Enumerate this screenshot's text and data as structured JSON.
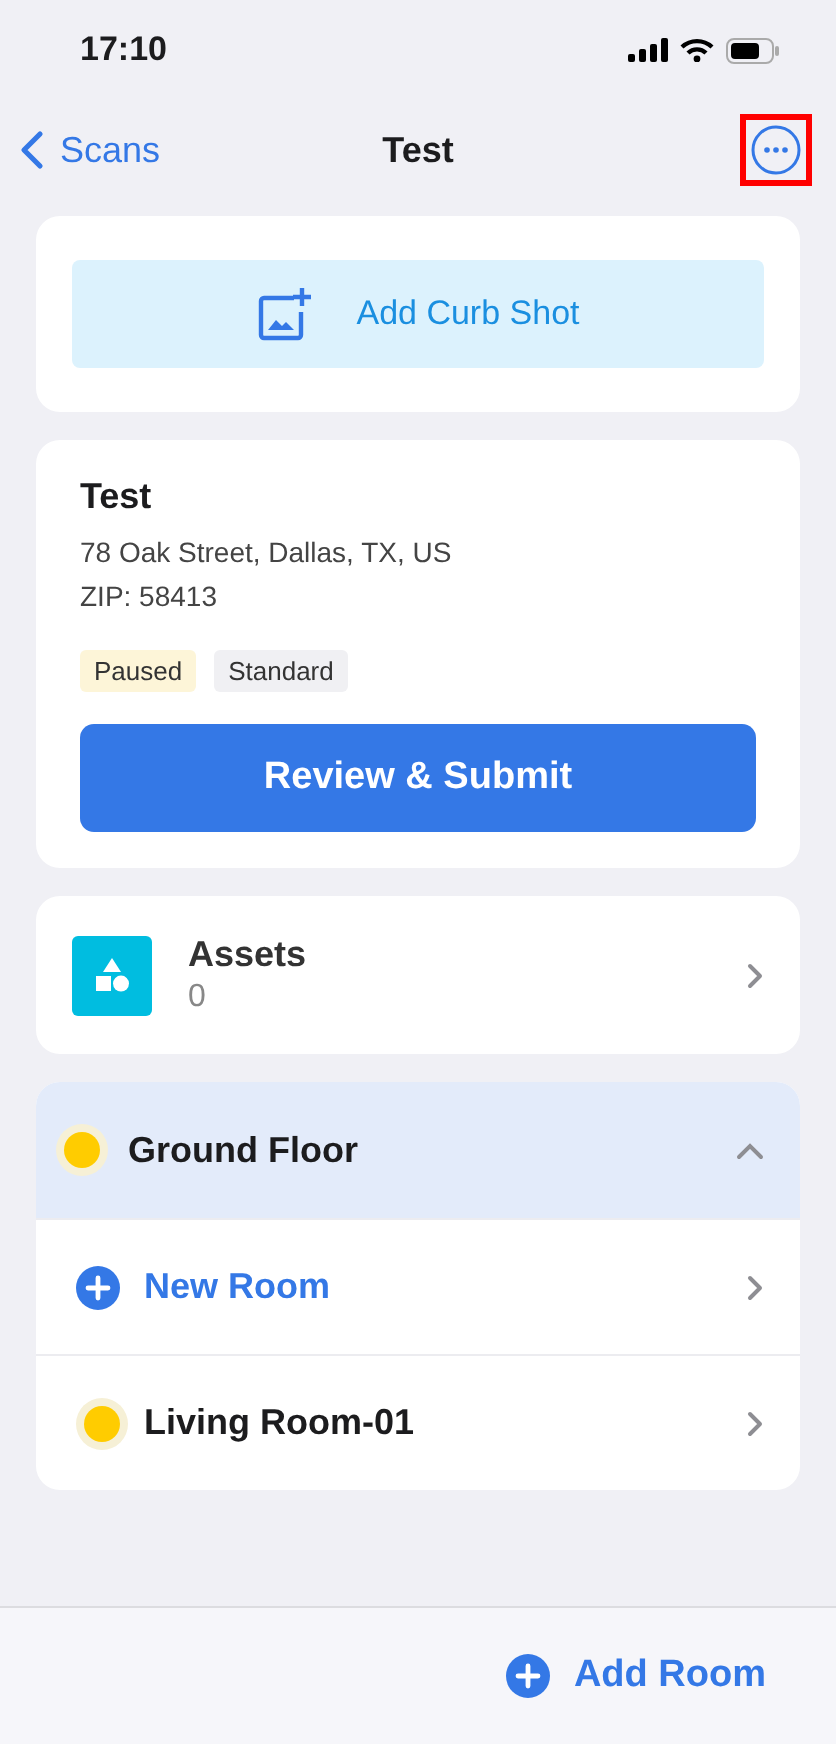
{
  "status_bar": {
    "time": "17:10"
  },
  "nav": {
    "back_label": "Scans",
    "title": "Test",
    "more_highlighted": true
  },
  "curb_shot": {
    "label": "Add Curb Shot"
  },
  "scan": {
    "name": "Test",
    "address": "78 Oak Street, Dallas, TX, US",
    "zip": "ZIP: 58413",
    "tags": [
      {
        "label": "Paused",
        "kind": "status"
      },
      {
        "label": "Standard",
        "kind": "plain"
      }
    ],
    "submit_label": "Review & Submit"
  },
  "assets": {
    "label": "Assets",
    "count": "0"
  },
  "floors": [
    {
      "name": "Ground Floor",
      "color": "#ffcc00",
      "expanded": true,
      "rooms": [
        {
          "kind": "new",
          "name": "New Room"
        },
        {
          "kind": "room",
          "name": "Living Room-01",
          "color": "#ffcc00"
        }
      ]
    }
  ],
  "bottom_bar": {
    "add_label": "Add Room"
  }
}
